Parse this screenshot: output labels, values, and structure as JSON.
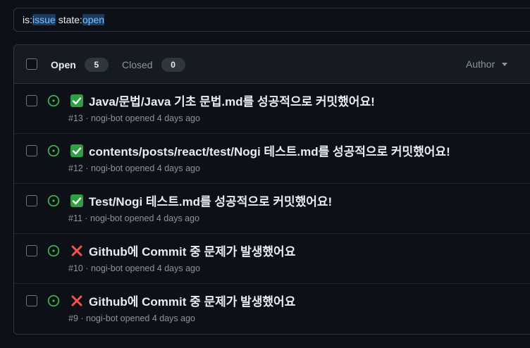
{
  "search": {
    "qualifier1_key": "is:",
    "qualifier1_value": "issue",
    "qualifier2_key": "state:",
    "qualifier2_value": "open"
  },
  "header": {
    "open_label": "Open",
    "open_count": "5",
    "closed_label": "Closed",
    "closed_count": "0",
    "author_label": "Author"
  },
  "issues": [
    {
      "status_icon": "check-mark-button-emoji",
      "title": "Java/문법/Java 기초 문법.md를 성공적으로 커밋했어요!",
      "meta": "#13 · nogi-bot opened 4 days ago"
    },
    {
      "status_icon": "check-mark-button-emoji",
      "title": "contents/posts/react/test/Nogi 테스트.md를 성공적으로 커밋했어요!",
      "meta": "#12 · nogi-bot opened 4 days ago"
    },
    {
      "status_icon": "check-mark-button-emoji",
      "title": "Test/Nogi 테스트.md를 성공적으로 커밋했어요!",
      "meta": "#11 · nogi-bot opened 4 days ago"
    },
    {
      "status_icon": "cross-mark-emoji",
      "title": "Github에 Commit 중 문제가 발생했어요",
      "meta": "#10 · nogi-bot opened 4 days ago"
    },
    {
      "status_icon": "cross-mark-emoji",
      "title": "Github에 Commit 중 문제가 발생했어요",
      "meta": "#9 · nogi-bot opened 4 days ago"
    }
  ],
  "colors": {
    "background": "#0d1117",
    "open_icon": "#3fb950",
    "check_emoji": "#2ea043",
    "cross_emoji": "#f85149",
    "muted_text": "#8b949e"
  }
}
